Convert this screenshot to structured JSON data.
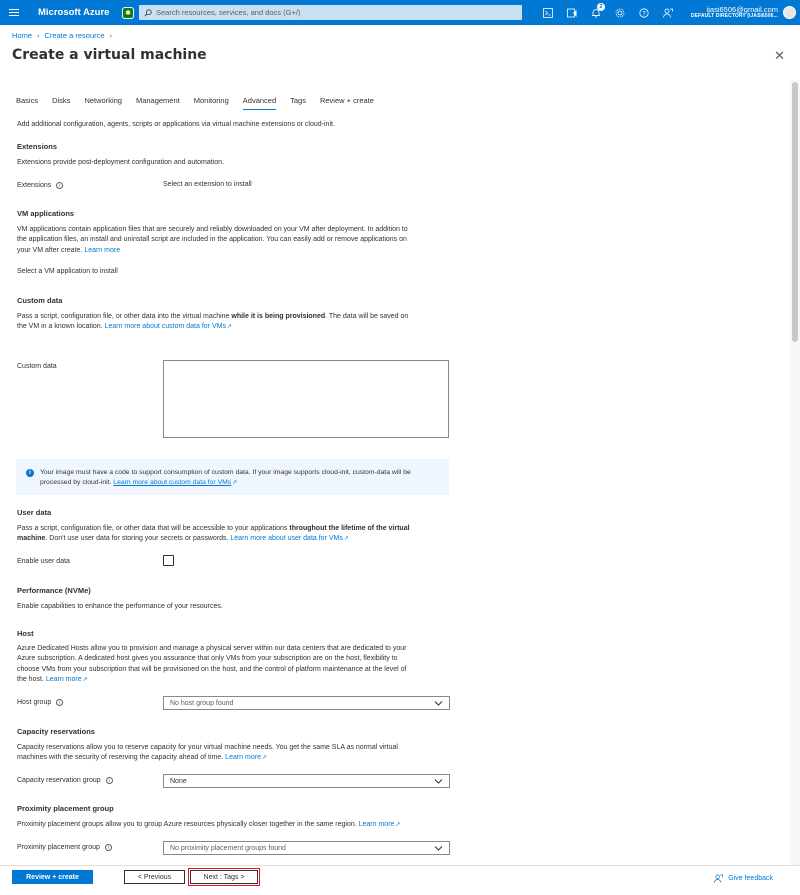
{
  "topbar": {
    "brand": "Microsoft Azure",
    "search_placeholder": "Search resources, services, and docs (G+/)",
    "notifications_count": "2",
    "user_email": "ijasi6506@gmail.com",
    "directory": "DEFAULT DIRECTORY (IJASI6506..."
  },
  "breadcrumb": [
    "Home",
    "Create a resource"
  ],
  "page_title": "Create a virtual machine",
  "tabs": [
    "Basics",
    "Disks",
    "Networking",
    "Management",
    "Monitoring",
    "Advanced",
    "Tags",
    "Review + create"
  ],
  "active_tab": "Advanced",
  "intro": "Add additional configuration, agents, scripts or applications via virtual machine extensions or cloud-init.",
  "extensions": {
    "heading": "Extensions",
    "description": "Extensions provide post-deployment configuration and automation.",
    "label": "Extensions",
    "link": "Select an extension to install"
  },
  "vm_apps": {
    "heading": "VM applications",
    "line1": "VM applications contain application files that are securely and reliably downloaded on your VM after deployment. In addition to",
    "line2": "the application files, an install and uninstall script are included in the application. You can easily add or remove applications on",
    "line3": "your VM after create.",
    "learn_more": "Learn more",
    "link": "Select a VM application to install"
  },
  "custom_data": {
    "heading": "Custom data",
    "line1_pre": "Pass a script, configuration file, or other data into the virtual machine ",
    "line1_bold": "while it is being provisioned",
    "line1_post": ". The data will be saved on",
    "line2": "the VM in a known location.",
    "learn_more": "Learn more about custom data for VMs",
    "label": "Custom data",
    "info_line1": "Your image must have a code to support consumption of custom data. If your image supports cloud-init, custom-data will be",
    "info_line2": "processed by cloud-init.",
    "info_link": "Learn more about custom data for VMs"
  },
  "user_data": {
    "heading": "User data",
    "line1_pre": "Pass a script, configuration file, or other data that will be accessible to your applications ",
    "line1_bold": "throughout the lifetime of the virtual",
    "line2_bold": "machine",
    "line2_post": ". Don't use user data for storing your secrets or passwords.",
    "learn_more": "Learn more about user data for VMs",
    "label": "Enable user data"
  },
  "performance": {
    "heading": "Performance (NVMe)",
    "description": "Enable capabilities to enhance the performance of your resources."
  },
  "host": {
    "heading": "Host",
    "line1": "Azure Dedicated Hosts allow you to provision and manage a physical server within our data centers that are dedicated to your",
    "line2": "Azure subscription. A dedicated host gives you assurance that only VMs from your subscription are on the host, flexibility to",
    "line3": "choose VMs from your subscription that will be provisioned on the host, and the control of platform maintenance at the level of",
    "line4": "the host.",
    "learn_more": "Learn more",
    "label": "Host group",
    "value": "No host group found"
  },
  "capacity": {
    "heading": "Capacity reservations",
    "line1": "Capacity reservations allow you to reserve capacity for your virtual machine needs. You get the same SLA as normal virtual",
    "line2": "machines with the security of reserving the capacity ahead of time.",
    "learn_more": "Learn more",
    "label": "Capacity reservation group",
    "value": "None"
  },
  "proximity": {
    "heading": "Proximity placement group",
    "description": "Proximity placement groups allow you to group Azure resources physically closer together in the same region.",
    "learn_more": "Learn more",
    "label": "Proximity placement group",
    "value": "No proximity placement groups found"
  },
  "footer": {
    "review_create": "Review + create",
    "previous": "< Previous",
    "next": "Next : Tags >",
    "feedback": "Give feedback"
  },
  "colors": {
    "accent": "#0078d4",
    "highlight_outline": "#e81123"
  }
}
